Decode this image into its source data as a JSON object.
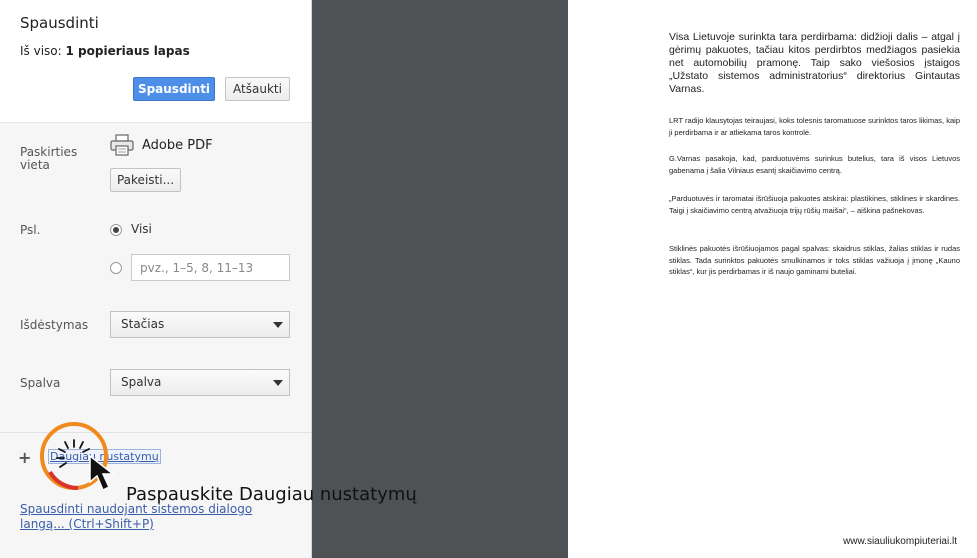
{
  "dialog": {
    "title": "Spausdinti",
    "summary_prefix": "Iš viso: ",
    "summary_value": "1 popieriaus lapas",
    "print_button": "Spausdinti",
    "cancel_button": "Atšaukti"
  },
  "destination": {
    "label": "Paskirties vieta",
    "name": "Adobe PDF",
    "change_button": "Pakeisti..."
  },
  "pages": {
    "label": "Psl.",
    "all_option": "Visi",
    "all_selected": true,
    "custom_placeholder": "pvz., 1–5, 8, 11–13"
  },
  "layout": {
    "label": "Išdėstymas",
    "value": "Stačias"
  },
  "color": {
    "label": "Spalva",
    "value": "Spalva"
  },
  "more_settings": {
    "link": "Daugiau nustatymų"
  },
  "system_dialog": {
    "link": "Spausdinti naudojant sistemos dialogo langą... (Ctrl+Shift+P)"
  },
  "preview": {
    "paragraphs": [
      "Visa Lietuvoje surinkta tara perdirbama: didžioji dalis – atgal į gėrimų pakuotes, tačiau kitos perdirbtos medžiagos pasiekia net automobilių pramonę. Taip sako viešosios įstaigos „Užstato sistemos administratorius“ direktorius Gintautas Varnas.",
      "LRT radijo klausytojas teiraujasi, koks tolesnis taromatuose surinktos taros likimas, kaip ji perdirbama ir ar atliekama taros kontrolė.",
      "G.Varnas pasakoja, kad, parduotuvėms surinkus butelius, tara iš visos Lietuvos gabenama į šalia Vilniaus esantį skaičiavimo centrą.",
      "„Parduotuvės ir taromatai išrūšiuoja pakuotes atskirai: plastikines, stiklines ir skardines. Taigi į skaičiavimo centrą atvažiuoja trijų rūšių maišai“, – aiškina pašnekovas.",
      "Stiklinės pakuotės išrūšiuojamos pagal spalvas: skaidrus stiklas, žalias stiklas ir rudas stiklas. Tada surinktos pakuotės smulkinamos ir toks stiklas važiuoja į įmonę „Kauno stiklas“, kur jis perdirbamas ir iš naujo gaminami buteliai."
    ]
  },
  "overlay": {
    "annotation": "Paspauskite Daugiau nustatymų",
    "watermark": "www.siauliukompiuteriai.lt",
    "ring_color": "#f08a1c"
  },
  "colors": {
    "primary_button": "#4c8ee8",
    "preview_background": "#4e5254",
    "link": "#3b5ea8"
  }
}
